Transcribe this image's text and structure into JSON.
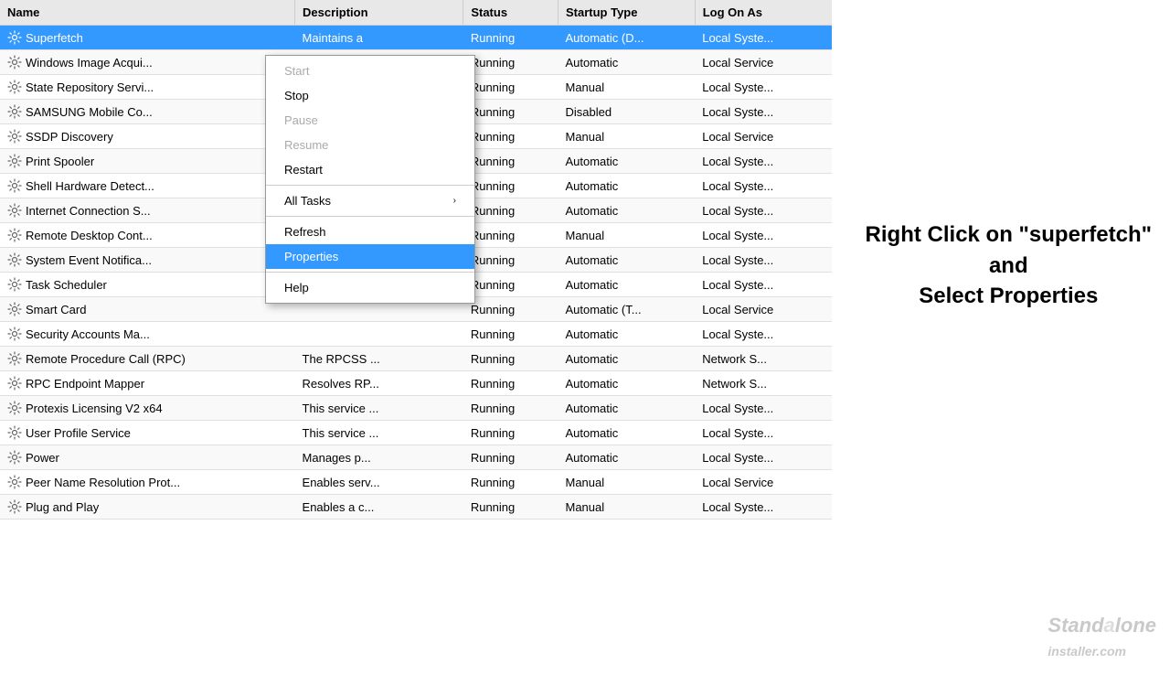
{
  "table": {
    "columns": [
      "Name",
      "Description",
      "Status",
      "Startup Type",
      "Log On As"
    ],
    "rows": [
      {
        "name": "Superfetch",
        "description": "Maintains a",
        "status": "Running",
        "startup": "Automatic (D...",
        "logon": "Local Syste...",
        "selected": true
      },
      {
        "name": "Windows Image Acqui...",
        "description": "",
        "status": "Running",
        "startup": "Automatic",
        "logon": "Local Service",
        "selected": false
      },
      {
        "name": "State Repository Servi...",
        "description": "",
        "status": "Running",
        "startup": "Manual",
        "logon": "Local Syste...",
        "selected": false
      },
      {
        "name": "SAMSUNG Mobile Co...",
        "description": "",
        "status": "Running",
        "startup": "Disabled",
        "logon": "Local Syste...",
        "selected": false
      },
      {
        "name": "SSDP Discovery",
        "description": "",
        "status": "Running",
        "startup": "Manual",
        "logon": "Local Service",
        "selected": false
      },
      {
        "name": "Print Spooler",
        "description": "",
        "status": "Running",
        "startup": "Automatic",
        "logon": "Local Syste...",
        "selected": false
      },
      {
        "name": "Shell Hardware Detect...",
        "description": "",
        "status": "Running",
        "startup": "Automatic",
        "logon": "Local Syste...",
        "selected": false
      },
      {
        "name": "Internet Connection S...",
        "description": "",
        "status": "Running",
        "startup": "Automatic",
        "logon": "Local Syste...",
        "selected": false
      },
      {
        "name": "Remote Desktop Cont...",
        "description": "",
        "status": "Running",
        "startup": "Manual",
        "logon": "Local Syste...",
        "selected": false
      },
      {
        "name": "System Event Notifica...",
        "description": "",
        "status": "Running",
        "startup": "Automatic",
        "logon": "Local Syste...",
        "selected": false
      },
      {
        "name": "Task Scheduler",
        "description": "",
        "status": "Running",
        "startup": "Automatic",
        "logon": "Local Syste...",
        "selected": false
      },
      {
        "name": "Smart Card",
        "description": "",
        "status": "Running",
        "startup": "Automatic (T...",
        "logon": "Local Service",
        "selected": false
      },
      {
        "name": "Security Accounts Ma...",
        "description": "",
        "status": "Running",
        "startup": "Automatic",
        "logon": "Local Syste...",
        "selected": false
      },
      {
        "name": "Remote Procedure Call (RPC)",
        "description": "The RPCSS ...",
        "status": "Running",
        "startup": "Automatic",
        "logon": "Network S...",
        "selected": false
      },
      {
        "name": "RPC Endpoint Mapper",
        "description": "Resolves RP...",
        "status": "Running",
        "startup": "Automatic",
        "logon": "Network S...",
        "selected": false
      },
      {
        "name": "Protexis Licensing V2 x64",
        "description": "This service ...",
        "status": "Running",
        "startup": "Automatic",
        "logon": "Local Syste...",
        "selected": false
      },
      {
        "name": "User Profile Service",
        "description": "This service ...",
        "status": "Running",
        "startup": "Automatic",
        "logon": "Local Syste...",
        "selected": false
      },
      {
        "name": "Power",
        "description": "Manages p...",
        "status": "Running",
        "startup": "Automatic",
        "logon": "Local Syste...",
        "selected": false
      },
      {
        "name": "Peer Name Resolution Prot...",
        "description": "Enables serv...",
        "status": "Running",
        "startup": "Manual",
        "logon": "Local Service",
        "selected": false
      },
      {
        "name": "Plug and Play",
        "description": "Enables a c...",
        "status": "Running",
        "startup": "Manual",
        "logon": "Local Syste...",
        "selected": false
      }
    ]
  },
  "contextMenu": {
    "items": [
      {
        "label": "Start",
        "disabled": true,
        "separator": false,
        "submenu": false
      },
      {
        "label": "Stop",
        "disabled": false,
        "separator": false,
        "submenu": false
      },
      {
        "label": "Pause",
        "disabled": true,
        "separator": false,
        "submenu": false
      },
      {
        "label": "Resume",
        "disabled": true,
        "separator": false,
        "submenu": false
      },
      {
        "label": "Restart",
        "disabled": false,
        "separator": false,
        "submenu": false
      },
      {
        "label": "SEPARATOR",
        "disabled": false,
        "separator": true,
        "submenu": false
      },
      {
        "label": "All Tasks",
        "disabled": false,
        "separator": false,
        "submenu": true
      },
      {
        "label": "SEPARATOR",
        "disabled": false,
        "separator": true,
        "submenu": false
      },
      {
        "label": "Refresh",
        "disabled": false,
        "separator": false,
        "submenu": false
      },
      {
        "label": "Properties",
        "disabled": false,
        "separator": false,
        "submenu": false,
        "highlighted": true
      },
      {
        "label": "SEPARATOR",
        "disabled": false,
        "separator": true,
        "submenu": false
      },
      {
        "label": "Help",
        "disabled": false,
        "separator": false,
        "submenu": false
      }
    ]
  },
  "annotation": {
    "line1": "Right Click on \"superfetch\"",
    "line2": "and",
    "line3": "Select Properties"
  },
  "watermark": {
    "text": "Standalone",
    "subtext": "installer.com"
  }
}
